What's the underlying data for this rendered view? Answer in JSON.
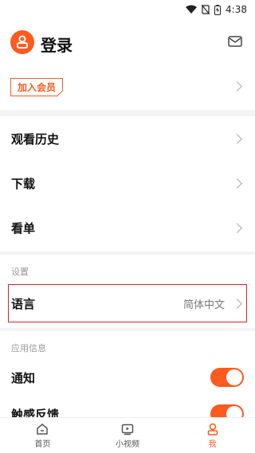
{
  "status": {
    "time": "4:38"
  },
  "header": {
    "login_label": "登录"
  },
  "vip": {
    "label": "加入会员"
  },
  "menu": [
    {
      "label": "观看历史"
    },
    {
      "label": "下载"
    },
    {
      "label": "看单"
    }
  ],
  "settings": {
    "section_label": "设置",
    "language": {
      "label": "语言",
      "value": "简体中文"
    }
  },
  "app_info": {
    "section_label": "应用信息",
    "notifications": {
      "label": "通知",
      "enabled": true
    },
    "haptic": {
      "label": "触感反馈",
      "enabled": true
    }
  },
  "bottom_nav": [
    {
      "label": "首页",
      "icon": "home-icon"
    },
    {
      "label": "小视频",
      "icon": "short-video-icon"
    },
    {
      "label": "我",
      "icon": "profile-icon",
      "active": true
    }
  ],
  "colors": {
    "accent": "#ff5a1f",
    "highlight_border": "#d32525"
  }
}
